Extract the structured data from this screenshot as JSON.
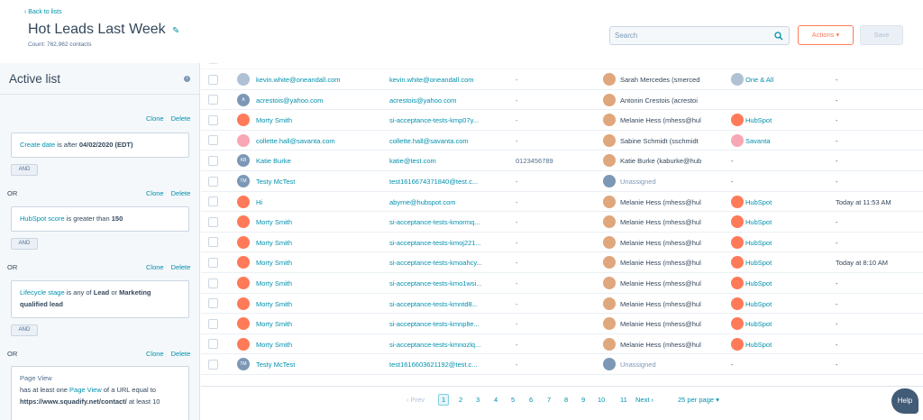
{
  "header": {
    "back_label": "Back to lists",
    "title": "Hot Leads Last Week",
    "count": "Count: 762,962 contacts",
    "search_placeholder": "Search",
    "actions_label": "Actions ▾",
    "save_label": "Save"
  },
  "sidebar": {
    "title": "Active list",
    "clone": "Clone",
    "delete": "Delete",
    "or": "OR",
    "and": "AND",
    "filters": [
      {
        "prop": "Create date",
        "text": " is after ",
        "value": "04/02/2020 (EDT)"
      },
      {
        "prop": "HubSpot score",
        "text": " is greater than ",
        "value": "150"
      },
      {
        "prop": "Lifecycle stage",
        "text": " is any of ",
        "value": "Lead",
        "text2": " or ",
        "value2": "Marketing qualified lead"
      },
      {
        "prop": "Page View",
        "line1": "has at least one ",
        "link": "Page View",
        "line2": " of a URL equal to",
        "url": "https://www.squadify.net/contact/",
        "tail": " at least 10"
      }
    ]
  },
  "rows": [
    {
      "av": "",
      "name": "kevin.white@oneandall.com",
      "email": "kevin.white@oneandall.com",
      "phone": "-",
      "owner": "Sarah Mercedes (smerced",
      "company": "One & All",
      "activity": "-"
    },
    {
      "av": "A",
      "name": "acrestois@yahoo.com",
      "email": "acrestois@yahoo.com",
      "phone": "-",
      "owner": "Antonin Crestois (acrestoi",
      "company": "",
      "activity": "-"
    },
    {
      "av": "",
      "name": "Morty Smith",
      "email": "si-acceptance-tests-kmp07y...",
      "phone": "-",
      "owner": "Melanie Hess (mhess@hul",
      "company": "HubSpot",
      "activity": "-"
    },
    {
      "av": "",
      "name": "collette.hall@savanta.com",
      "email": "collette.hall@savanta.com",
      "phone": "-",
      "owner": "Sabine Schmidt (sschmidt",
      "company": "Savanta",
      "activity": "-"
    },
    {
      "av": "KB",
      "name": "Katie Burke",
      "email": "katie@test.com",
      "phone": "0123456789",
      "owner": "Katie Burke (kaburke@hub",
      "company": "-",
      "activity": "-"
    },
    {
      "av": "TM",
      "name": "Testy McTest",
      "email": "test1616674371840@test.c...",
      "phone": "-",
      "owner": "Unassigned",
      "company": "-",
      "activity": "-"
    },
    {
      "av": "",
      "name": "Hi",
      "email": "abyrne@hubspot.com",
      "phone": "-",
      "owner": "Melanie Hess (mhess@hul",
      "company": "HubSpot",
      "activity": "Today at 11:53 AM"
    },
    {
      "av": "",
      "name": "Morty Smith",
      "email": "si-acceptance-tests-kmormq...",
      "phone": "-",
      "owner": "Melanie Hess (mhess@hul",
      "company": "HubSpot",
      "activity": "-"
    },
    {
      "av": "",
      "name": "Morty Smith",
      "email": "si-acceptance-tests-kmoj221...",
      "phone": "-",
      "owner": "Melanie Hess (mhess@hul",
      "company": "HubSpot",
      "activity": "-"
    },
    {
      "av": "",
      "name": "Morty Smith",
      "email": "si-acceptance-tests-kmoahcy...",
      "phone": "-",
      "owner": "Melanie Hess (mhess@hul",
      "company": "HubSpot",
      "activity": "Today at 8:10 AM"
    },
    {
      "av": "",
      "name": "Morty Smith",
      "email": "si-acceptance-tests-kmo1wsi...",
      "phone": "-",
      "owner": "Melanie Hess (mhess@hul",
      "company": "HubSpot",
      "activity": "-"
    },
    {
      "av": "",
      "name": "Morty Smith",
      "email": "si-acceptance-tests-kmntd8...",
      "phone": "-",
      "owner": "Melanie Hess (mhess@hul",
      "company": "HubSpot",
      "activity": "-"
    },
    {
      "av": "",
      "name": "Morty Smith",
      "email": "si-acceptance-tests-kmnplte...",
      "phone": "-",
      "owner": "Melanie Hess (mhess@hul",
      "company": "HubSpot",
      "activity": "-"
    },
    {
      "av": "",
      "name": "Morty Smith",
      "email": "si-acceptance-tests-kmnozlq...",
      "phone": "-",
      "owner": "Melanie Hess (mhess@hul",
      "company": "HubSpot",
      "activity": "-"
    },
    {
      "av": "TM",
      "name": "Testy McTest",
      "email": "test1616603621192@test.c...",
      "phone": "-",
      "owner": "Unassigned",
      "company": "-",
      "activity": "-"
    }
  ],
  "pager": {
    "prev": "Prev",
    "pages": [
      "1",
      "2",
      "3",
      "4",
      "5",
      "6",
      "7",
      "8",
      "9",
      "10",
      "11"
    ],
    "next": "Next",
    "per_page": "25 per page ▾"
  },
  "help_label": "Help"
}
